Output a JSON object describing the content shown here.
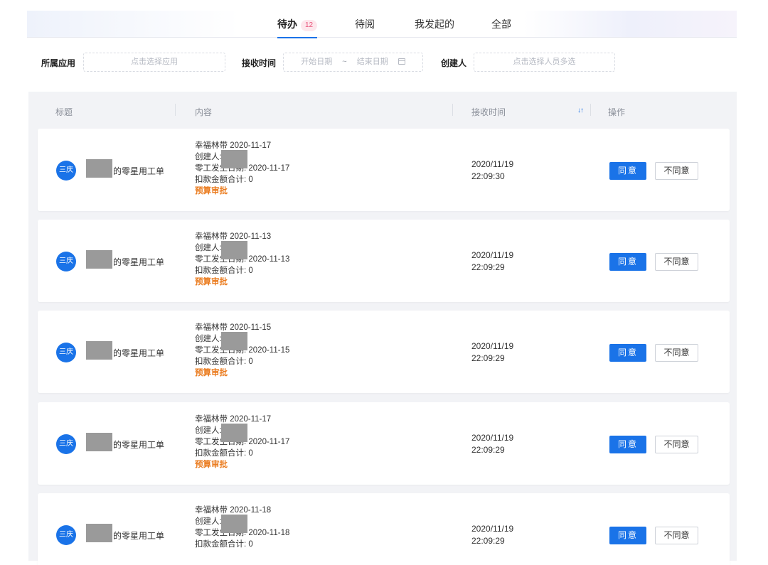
{
  "tabs": [
    {
      "label": "待办",
      "badge": "12",
      "active": true
    },
    {
      "label": "待阅"
    },
    {
      "label": "我发起的"
    },
    {
      "label": "全部"
    }
  ],
  "filters": {
    "app_label": "所属应用",
    "app_placeholder": "点击选择应用",
    "time_label": "接收时间",
    "start_placeholder": "开始日期",
    "range_sep": "~",
    "end_placeholder": "结束日期",
    "creator_label": "创建人",
    "creator_placeholder": "点击选择人员多选"
  },
  "table": {
    "headers": {
      "title": "标题",
      "content": "内容",
      "time": "接收时间",
      "action": "操作"
    },
    "rows": [
      {
        "avatar": "三庆",
        "title": "的零星用工单",
        "line1": "幸福林带 2020-11-17",
        "line2": "创建人:",
        "line3": "零工发生日期: 2020-11-17",
        "line4": "扣款金额合计: 0",
        "line5": "预算审批",
        "date": "2020/11/19",
        "time": "22:09:30",
        "agree": "同意",
        "disagree": "不同意"
      },
      {
        "avatar": "三庆",
        "title": "的零星用工单",
        "line1": "幸福林带 2020-11-13",
        "line2": "创建人:",
        "line3": "零工发生日期: 2020-11-13",
        "line4": "扣款金额合计: 0",
        "line5": "预算审批",
        "date": "2020/11/19",
        "time": "22:09:29",
        "agree": "同意",
        "disagree": "不同意"
      },
      {
        "avatar": "三庆",
        "title": "的零星用工单",
        "line1": "幸福林带 2020-11-15",
        "line2": "创建人:",
        "line3": "零工发生日期: 2020-11-15",
        "line4": "扣款金额合计: 0",
        "line5": "预算审批",
        "date": "2020/11/19",
        "time": "22:09:29",
        "agree": "同意",
        "disagree": "不同意"
      },
      {
        "avatar": "三庆",
        "title": "的零星用工单",
        "line1": "幸福林带 2020-11-17",
        "line2": "创建人:",
        "line3": "零工发生日期: 2020-11-17",
        "line4": "扣款金额合计: 0",
        "line5": "预算审批",
        "date": "2020/11/19",
        "time": "22:09:29",
        "agree": "同意",
        "disagree": "不同意"
      },
      {
        "avatar": "三庆",
        "title": "的零星用工单",
        "line1": "幸福林带 2020-11-18",
        "line2": "创建人:",
        "line3": "零工发生日期: 2020-11-18",
        "line4": "扣款金额合计: 0",
        "line5": "",
        "date": "2020/11/19",
        "time": "22:09:29",
        "agree": "同意",
        "disagree": "不同意"
      }
    ]
  }
}
